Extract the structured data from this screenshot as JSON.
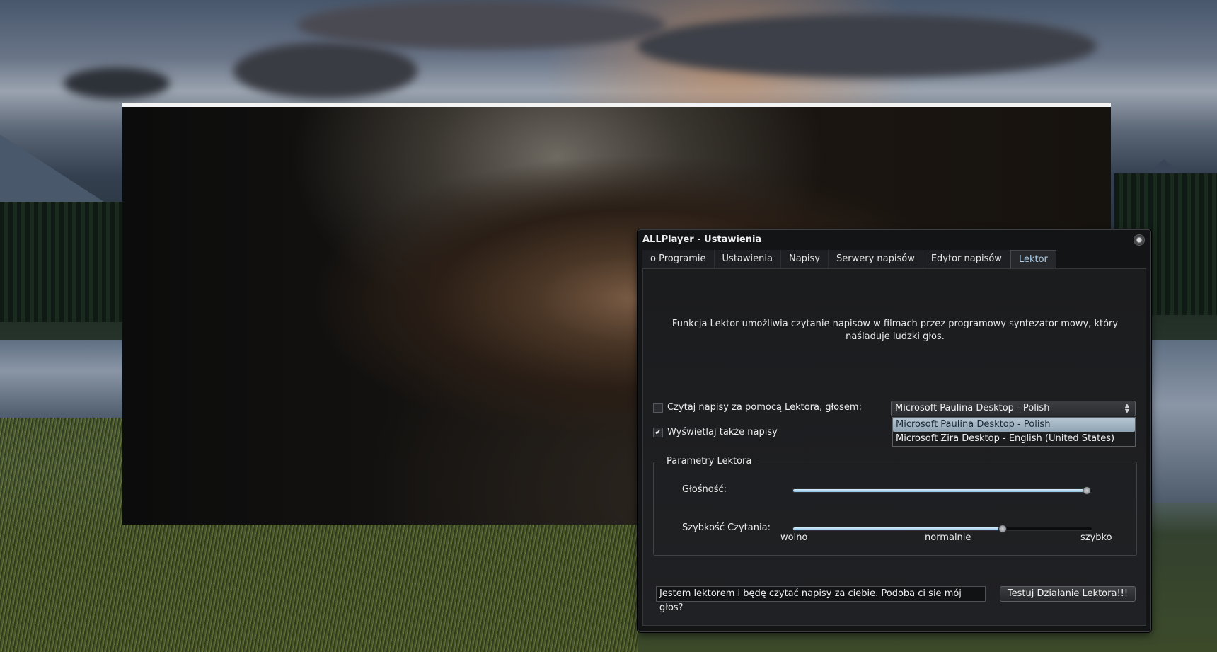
{
  "dialog": {
    "title": "ALLPlayer - Ustawienia"
  },
  "tabs": [
    {
      "label": "o Programie"
    },
    {
      "label": "Ustawienia"
    },
    {
      "label": "Napisy"
    },
    {
      "label": "Serwery napisów"
    },
    {
      "label": "Edytor napisów"
    },
    {
      "label": "Lektor",
      "active": true
    }
  ],
  "lektor": {
    "description": "Funkcja Lektor umożliwia czytanie napisów w filmach przez programowy syntezator mowy, który naśladuje ludzki głos.",
    "read_checkbox": {
      "label": "Czytaj napisy za pomocą Lektora, głosem:",
      "checked": false
    },
    "display_checkbox": {
      "label": "Wyświetlaj także napisy",
      "checked": true
    },
    "voice_combo": {
      "selected": "Microsoft Paulina Desktop - Polish",
      "options": [
        "Microsoft Paulina Desktop - Polish",
        "Microsoft Zira Desktop - English (United States)"
      ]
    },
    "params_group": {
      "title": "Parametry Lektora",
      "volume_label": "Głośność:",
      "volume_value": 0.98,
      "speed_label": "Szybkość Czytania:",
      "speed_value": 0.7,
      "speed_min_label": "wolno",
      "speed_mid_label": "normalnie",
      "speed_max_label": "szybko"
    },
    "test_text": "Jestem lektorem i będę czytać napisy za ciebie. Podoba ci sie mój głos?",
    "test_button": "Testuj Działanie Lektora!!!"
  },
  "icons": {
    "close": "close-icon",
    "checkmark": "checkmark-icon",
    "combo_arrows": "updown-arrows-icon"
  },
  "colors": {
    "accent": "#a9cde8",
    "slider_fill": "#b5dbf2",
    "selection": "#9fb3c3"
  }
}
